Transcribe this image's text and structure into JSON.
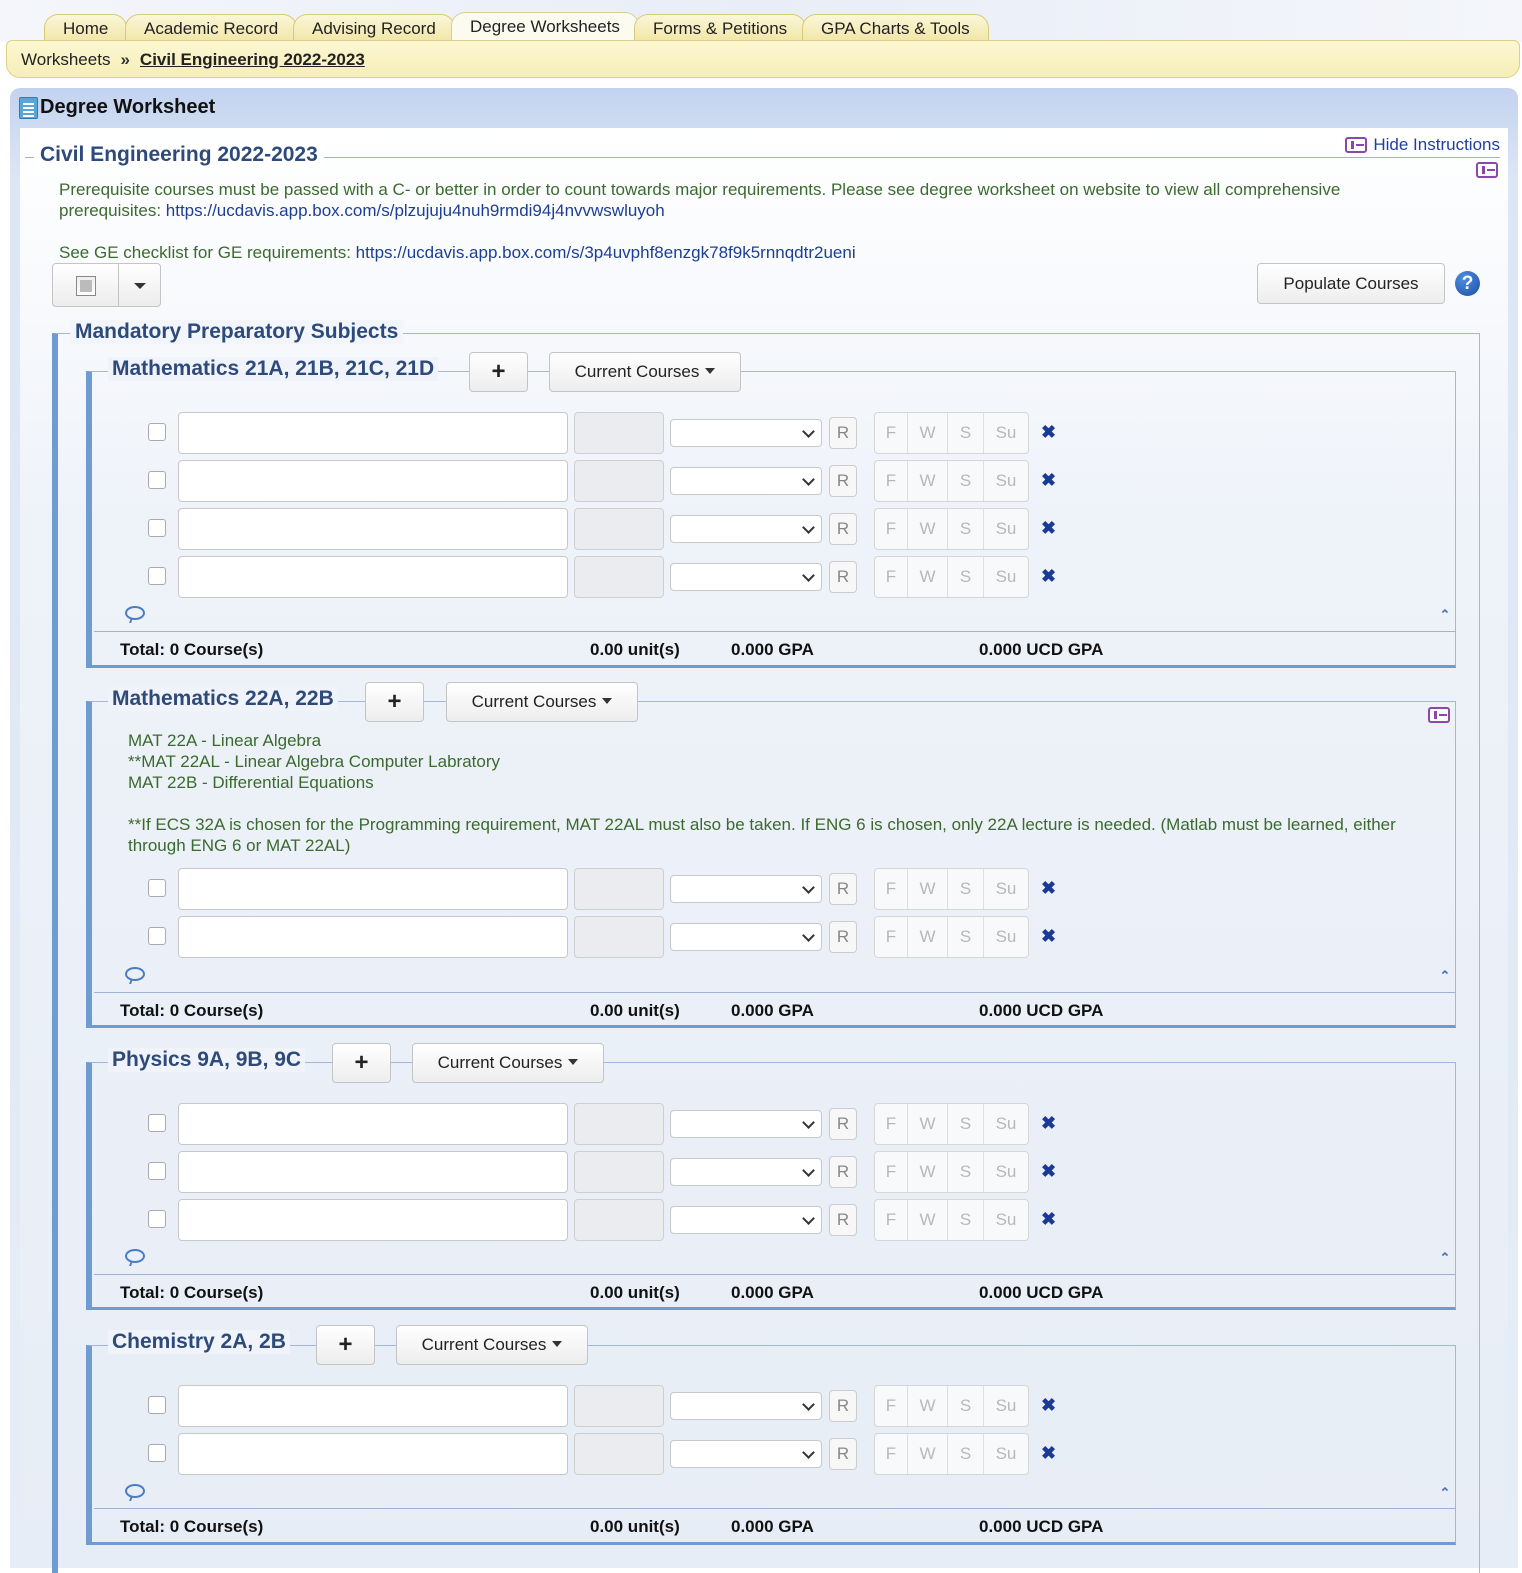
{
  "nav": {
    "tabs": [
      {
        "label": "Home"
      },
      {
        "label": "Academic Record"
      },
      {
        "label": "Advising Record"
      },
      {
        "label": "Degree Worksheets",
        "active": true
      },
      {
        "label": "Forms & Petitions"
      },
      {
        "label": "GPA Charts & Tools"
      }
    ]
  },
  "breadcrumb": {
    "root": "Worksheets",
    "separator": "»",
    "current": "Civil Engineering 2022-2023"
  },
  "panel": {
    "title": "Degree Worksheet"
  },
  "worksheet": {
    "title": "Civil Engineering 2022-2023",
    "hide_instructions": "Hide Instructions",
    "instructions_1": "Prerequisite courses must be passed with a C- or better in order to count towards major requirements. Please see degree worksheet on website to view all comprehensive prerequisites: ",
    "instructions_1_link": "https://ucdavis.app.box.com/s/plzujuju4nuh9rmdi94j4nvvwswluyoh",
    "instructions_2": "See GE checklist for GE requirements: ",
    "instructions_2_link": "https://ucdavis.app.box.com/s/3p4uvphf8enzgk78f9k5rnnqdtr2ueni",
    "populate_label": "Populate Courses",
    "help_label": "?"
  },
  "mandatory": {
    "title": "Mandatory Preparatory Subjects"
  },
  "common": {
    "plus_label": "+",
    "current_courses_label": "Current Courses",
    "repeat_label": "R",
    "terms": [
      "F",
      "W",
      "S",
      "Su"
    ],
    "delete_label": "✖",
    "collapse_label": "⌃"
  },
  "sections": [
    {
      "title": "Mathematics 21A, 21B, 21C, 21D",
      "total_courses": "Total: 0 Course(s)",
      "total_units": "0.00 unit(s)",
      "total_gpa": "0.000 GPA",
      "total_ucd_gpa": "0.000 UCD GPA"
    },
    {
      "title": "Mathematics 22A, 22B",
      "desc_line1": "MAT 22A - Linear Algebra",
      "desc_line2": "**MAT 22AL - Linear Algebra Computer Labratory",
      "desc_line3": "MAT 22B - Differential Equations",
      "desc_note": "**If ECS 32A is chosen for the Programming requirement, MAT 22AL must also be taken. If ENG 6 is chosen, only 22A lecture is needed. (Matlab must be learned, either through ENG 6 or MAT 22AL)",
      "total_courses": "Total: 0 Course(s)",
      "total_units": "0.00 unit(s)",
      "total_gpa": "0.000 GPA",
      "total_ucd_gpa": "0.000 UCD GPA"
    },
    {
      "title": "Physics 9A, 9B, 9C",
      "total_courses": "Total: 0 Course(s)",
      "total_units": "0.00 unit(s)",
      "total_gpa": "0.000 GPA",
      "total_ucd_gpa": "0.000 UCD GPA"
    },
    {
      "title": "Chemistry 2A, 2B",
      "total_courses": "Total: 0 Course(s)",
      "total_units": "0.00 unit(s)",
      "total_gpa": "0.000 GPA",
      "total_ucd_gpa": "0.000 UCD GPA"
    }
  ]
}
